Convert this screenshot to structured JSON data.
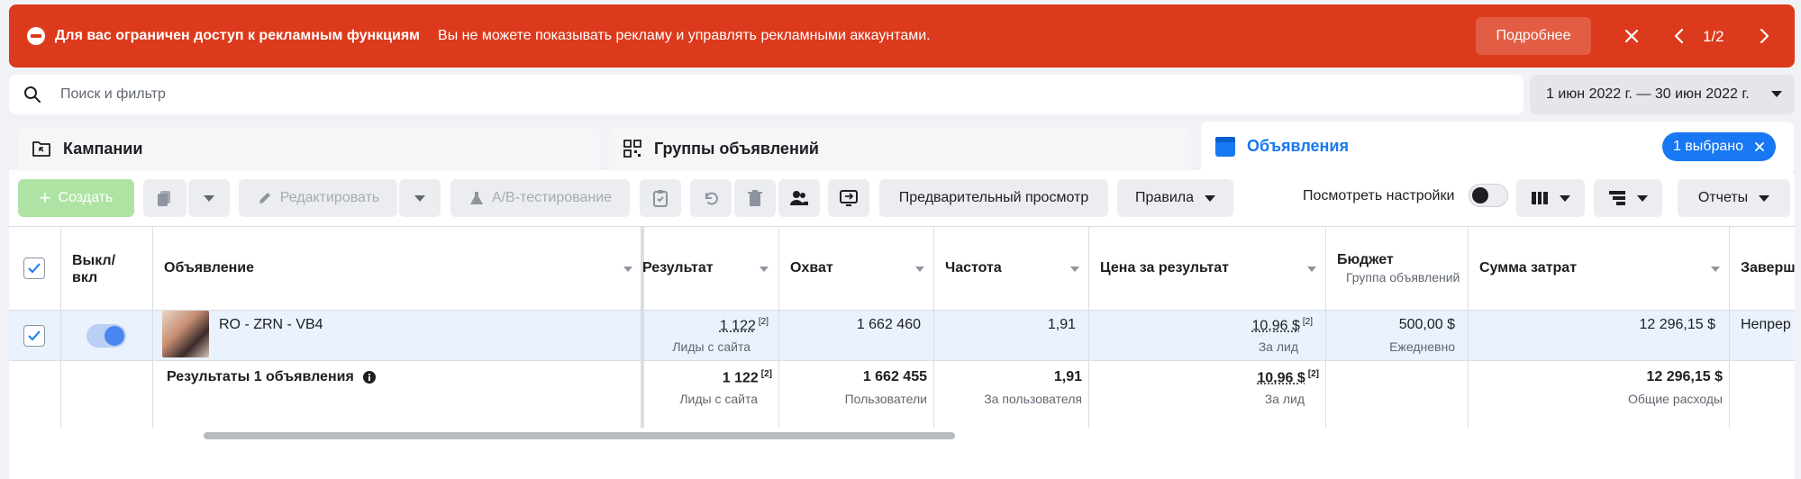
{
  "alert": {
    "title": "Для вас ограничен доступ к рекламным функциям",
    "message": "Вы не можете показывать рекламу и управлять рекламными аккаунтами.",
    "more_label": "Подробнее",
    "pager": "1/2",
    "color": "#dc3a1c"
  },
  "search": {
    "placeholder": "Поиск и фильтр"
  },
  "date_range": "1 июн 2022 г. — 30 июн 2022 г.",
  "tabs": {
    "campaigns": "Кампании",
    "adsets": "Группы объявлений",
    "ads": "Объявления",
    "ads_selected": "1 выбрано"
  },
  "toolbar": {
    "create": "Создать",
    "edit": "Редактировать",
    "ab_test": "A/B-тестирование",
    "preview": "Предварительный просмотр",
    "rules": "Правила",
    "view_settings": "Посмотреть настройки",
    "reports": "Отчеты"
  },
  "columns": {
    "toggle": "Выкл/ вкл",
    "ad": "Объявление",
    "result": "Результат",
    "reach": "Охват",
    "frequency": "Частота",
    "cost_per_result": "Цена за результат",
    "budget": "Бюджет",
    "budget_sub": "Группа объявлений",
    "amount_spent": "Сумма затрат",
    "ends": "Заверш"
  },
  "row": {
    "name": "RO - ZRN - VB4",
    "result": "1 122",
    "result_ref": "[2]",
    "result_sub": "Лиды с сайта",
    "reach": "1 662 460",
    "frequency": "1,91",
    "cost": "10,96 $",
    "cost_ref": "[2]",
    "cost_sub": "За лид",
    "budget": "500,00 $",
    "budget_sub": "Ежедневно",
    "spent": "12 296,15 $",
    "ends": "Непрер"
  },
  "total": {
    "label": "Результаты 1 объявления",
    "result": "1 122",
    "result_ref": "[2]",
    "result_sub": "Лиды с сайта",
    "reach": "1 662 455",
    "reach_sub": "Пользователи",
    "frequency": "1,91",
    "frequency_sub": "За пользователя",
    "cost": "10,96 $",
    "cost_ref": "[2]",
    "cost_sub": "За лид",
    "spent": "12 296,15 $",
    "spent_sub": "Общие расходы"
  }
}
